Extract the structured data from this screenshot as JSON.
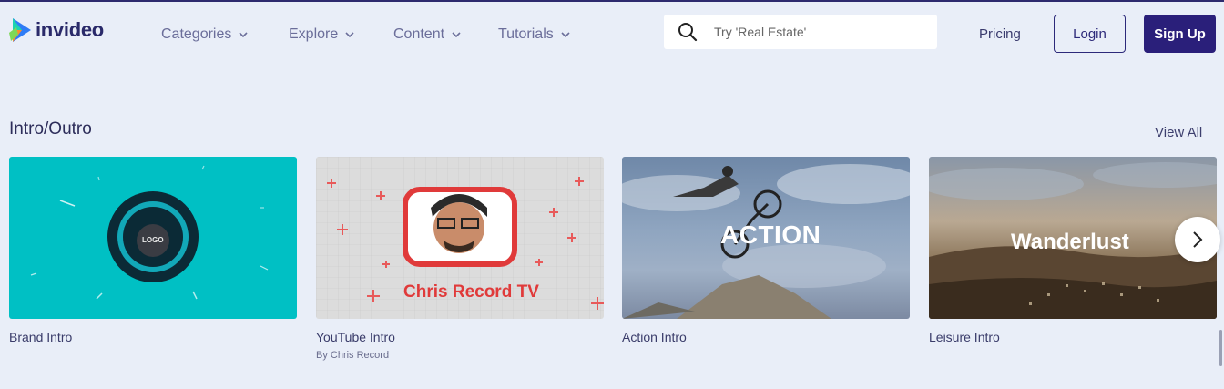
{
  "brand": {
    "name": "invideo"
  },
  "nav": [
    {
      "label": "Categories"
    },
    {
      "label": "Explore"
    },
    {
      "label": "Content"
    },
    {
      "label": "Tutorials"
    }
  ],
  "search": {
    "placeholder": "Try 'Real Estate'"
  },
  "header": {
    "pricing": "Pricing",
    "login": "Login",
    "signup": "Sign Up"
  },
  "section": {
    "title": "Intro/Outro",
    "view_all": "View All"
  },
  "cards": [
    {
      "title": "Brand Intro",
      "thumb_text": "LOGO"
    },
    {
      "title": "YouTube Intro",
      "author": "By Chris Record",
      "thumb_text": "Chris Record TV"
    },
    {
      "title": "Action Intro",
      "thumb_text": "ACTION"
    },
    {
      "title": "Leisure Intro",
      "thumb_text": "Wanderlust"
    }
  ],
  "colors": {
    "brand_dark": "#2a1f7a",
    "teal": "#00c0c4",
    "background": "#e9eef8"
  }
}
